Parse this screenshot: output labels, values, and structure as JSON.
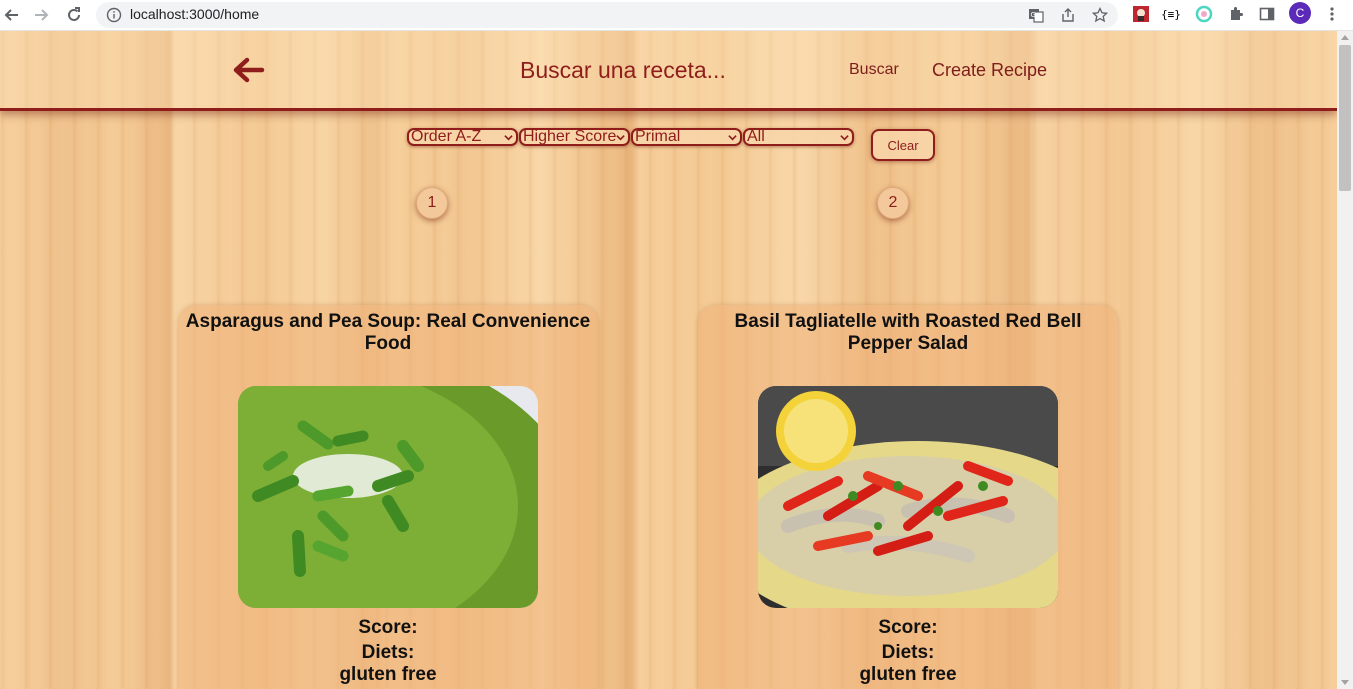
{
  "browser": {
    "url": "localhost:3000/home",
    "profile_initial": "C",
    "extension_label": "{≡}"
  },
  "header": {
    "search_placeholder": "Buscar una receta...",
    "search_label": "Buscar",
    "create_label": "Create Recipe"
  },
  "filters": {
    "order": "Order A-Z",
    "score": "Higher Score",
    "diet": "Primal",
    "origin": "All",
    "clear_label": "Clear"
  },
  "pagination": [
    "1",
    "2"
  ],
  "recipes": [
    {
      "title": "Asparagus and Pea Soup: Real Convenience Food",
      "score_label": "Score:",
      "diets_label": "Diets:",
      "diets": [
        "gluten free"
      ]
    },
    {
      "title": "Basil Tagliatelle with Roasted Red Bell Pepper Salad",
      "score_label": "Score:",
      "diets_label": "Diets:",
      "diets": [
        "gluten free"
      ]
    }
  ],
  "colors": {
    "accent": "#8e1d1b",
    "wood": "#f2c48e"
  }
}
